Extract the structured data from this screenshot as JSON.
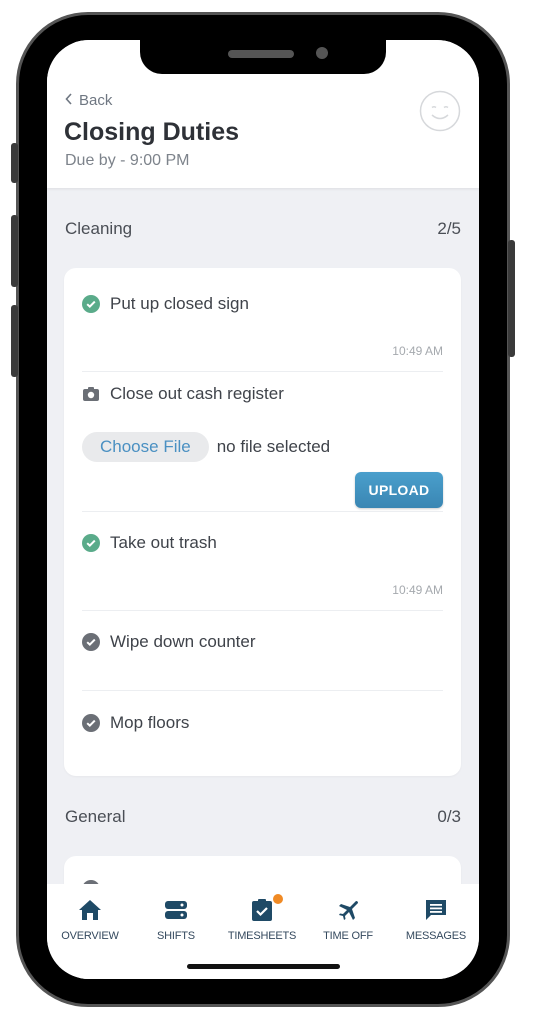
{
  "header": {
    "back_label": "Back",
    "title": "Closing Duties",
    "subtitle": "Due by - 9:00 PM"
  },
  "sections": [
    {
      "name": "Cleaning",
      "progress": "2/5",
      "tasks": [
        {
          "label": "Put up closed sign",
          "status": "done",
          "time": "10:49 AM"
        },
        {
          "label": "Close out cash register",
          "status": "photo_required",
          "file_button": "Choose File",
          "file_status": "no file selected",
          "upload_label": "UPLOAD"
        },
        {
          "label": "Take out trash",
          "status": "done",
          "time": "10:49 AM"
        },
        {
          "label": "Wipe down counter",
          "status": "pending"
        },
        {
          "label": "Mop floors",
          "status": "pending"
        }
      ]
    },
    {
      "name": "General",
      "progress": "0/3"
    }
  ],
  "colors": {
    "done": "#5aab8a",
    "pending": "#6b6f76",
    "accent": "#3a86b3",
    "nav": "#1f4a66",
    "badge": "#f08a24"
  },
  "tabbar": [
    {
      "label": "OVERVIEW",
      "icon": "home-icon"
    },
    {
      "label": "SHIFTS",
      "icon": "shifts-icon"
    },
    {
      "label": "TIMESHEETS",
      "icon": "timesheet-icon",
      "badge": true
    },
    {
      "label": "TIME OFF",
      "icon": "airplane-icon"
    },
    {
      "label": "MESSAGES",
      "icon": "message-icon"
    }
  ]
}
